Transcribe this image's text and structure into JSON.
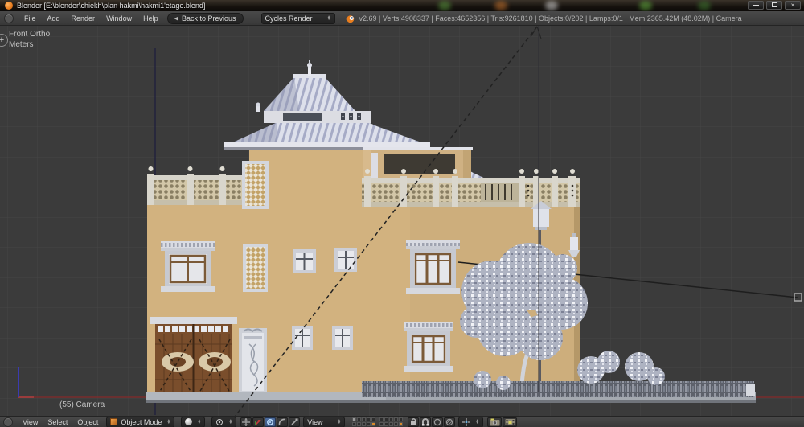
{
  "window": {
    "title": "Blender [E:\\blender\\chiekh\\plan hakmi\\hakmi1'etage.blend]",
    "controls": {
      "close_glyph": "×"
    }
  },
  "menu_bar": {
    "items": [
      "File",
      "Add",
      "Render",
      "Window",
      "Help"
    ],
    "back_button_label": "Back to Previous",
    "back_icon_glyph": "◀",
    "render_engine_value": "Cycles Render",
    "stats": "v2.69 | Verts:4908337 | Faces:4652356 | Tris:9261810 | Objects:0/202 | Lamps:0/1 | Mem:2365.42M (48.02M) | Camera"
  },
  "viewport": {
    "view_label": "Front Ortho",
    "unit_label": "Meters",
    "camera_label": "(55) Camera",
    "plus_glyph": "+"
  },
  "footer": {
    "menus": [
      "View",
      "Select",
      "Object"
    ],
    "mode_value": "Object Mode",
    "orientation_value": "View"
  },
  "colors": {
    "viewport_bg": "#3b3b3b",
    "grid_line": "#464646",
    "wall_tan": "#d2b27f",
    "roof_light": "#dde0eb",
    "roof_stripe": "#a6abc6",
    "door_brown": "#7a4e2c",
    "axis_red": "#7a2d2d",
    "axis_blue": "#3b3bb0"
  }
}
